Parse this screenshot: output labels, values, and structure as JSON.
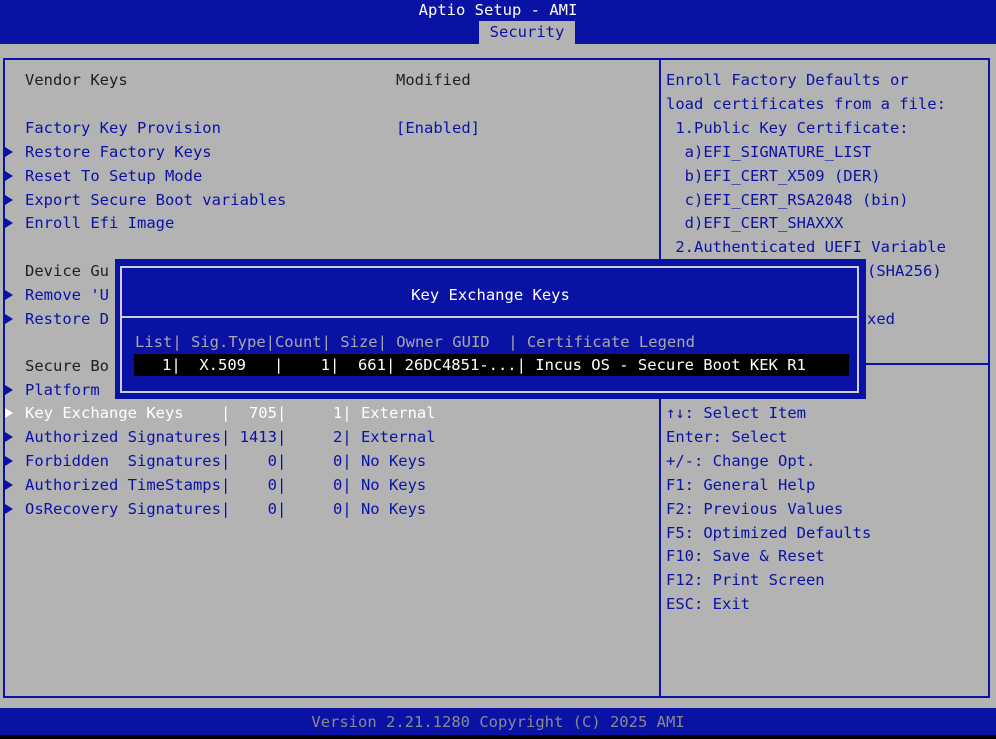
{
  "header": {
    "title": "Aptio Setup - AMI",
    "active_tab": "Security"
  },
  "left_panel": {
    "vendor_keys": {
      "label": "Vendor Keys",
      "value": "Modified"
    },
    "factory_key_provision": {
      "label": "Factory Key Provision",
      "value": "[Enabled]"
    },
    "items": [
      {
        "label": "Restore Factory Keys"
      },
      {
        "label": "Reset To Setup Mode"
      },
      {
        "label": "Export Secure Boot variables"
      },
      {
        "label": "Enroll Efi Image"
      }
    ],
    "device_guard_partial": "Device Gu",
    "remove_partial": "Remove 'U",
    "restore_partial": "Restore D",
    "secure_boot_partial": "Secure Bo",
    "platform_partial": "Platform",
    "key_rows": [
      {
        "label": "Key Exchange Keys    |  705|     1| External",
        "selected": true
      },
      {
        "label": "Authorized Signatures| 1413|     2| External",
        "selected": false
      },
      {
        "label": "Forbidden  Signatures|    0|     0| No Keys",
        "selected": false
      },
      {
        "label": "Authorized TimeStamps|    0|     0| No Keys",
        "selected": false
      },
      {
        "label": "OsRecovery Signatures|    0|     0| No Keys",
        "selected": false
      }
    ]
  },
  "help_panel": {
    "lines": [
      "Enroll Factory Defaults or",
      "load certificates from a file:",
      " 1.Public Key Certificate:",
      "  a)EFI_SIGNATURE_LIST",
      "  b)EFI_CERT_X509 (DER)",
      "  c)EFI_CERT_RSA2048 (bin)",
      "  d)EFI_CERT_SHAXXX",
      " 2.Authenticated UEFI Variable",
      "(SHA256)",
      "xed"
    ],
    "keys": [
      "↑↓: Select Item",
      "Enter: Select",
      "+/-: Change Opt.",
      "F1: General Help",
      "F2: Previous Values",
      "F5: Optimized Defaults",
      "F10: Save & Reset",
      "F12: Print Screen",
      "ESC: Exit"
    ]
  },
  "popup": {
    "title": "Key Exchange Keys",
    "header": "List| Sig.Type|Count| Size| Owner GUID  | Certificate Legend",
    "row": "   1|  X.509   |    1|  661| 26DC4851-...| Incus OS - Secure Boot KEK R1"
  },
  "footer": {
    "version": "Version 2.21.1280 Copyright (C) 2025 AMI"
  },
  "colors": {
    "bios_blue": "#0a12a6",
    "background": "#b3b3b3",
    "selected_text": "#ffffff"
  }
}
